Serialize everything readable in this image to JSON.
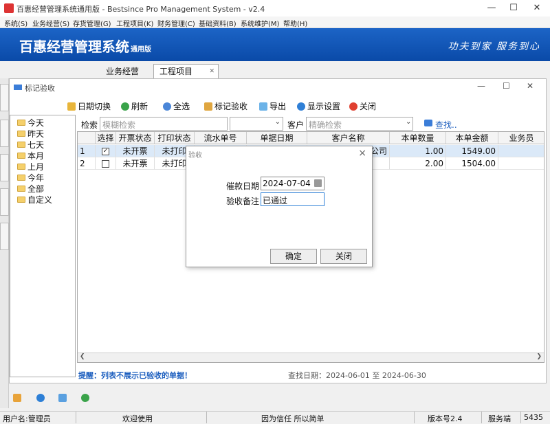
{
  "window": {
    "title": "百惠经营管理系统通用版 - Bestsince Pro Management System - v2.4",
    "minimize": "—",
    "maximize": "☐",
    "close": "✕"
  },
  "menu": [
    "系统(S)",
    "业务经营(S)",
    "存货管理(G)",
    "工程项目(K)",
    "财务管理(C)",
    "基础资料(B)",
    "系统维护(M)",
    "帮助(H)"
  ],
  "banner": {
    "brand": "百惠经营管理系统",
    "edition": "通用版",
    "slogan": "功夫到家 服务到心"
  },
  "tabs": [
    "业务经营",
    "工程项目"
  ],
  "tab_close": "✕",
  "inner": {
    "title": "标记验收",
    "minimize": "—",
    "maximize": "☐",
    "close": "✕"
  },
  "toolbar": {
    "date_toggle": "日期切换",
    "refresh": "刷新",
    "select_all": "全选",
    "mark_accept": "标记验收",
    "export": "导出",
    "display_settings": "显示设置",
    "close": "关闭"
  },
  "tree": [
    "今天",
    "昨天",
    "七天",
    "本月",
    "上月",
    "今年",
    "全部",
    "自定义"
  ],
  "search": {
    "label": "检索",
    "fuzzy_placeholder": "模糊检索",
    "customer_label": "客户",
    "exact_placeholder": "精确检索",
    "find": "查找.."
  },
  "grid": {
    "headers": [
      "选择",
      "开票状态",
      "打印状态",
      "流水单号",
      "单据日期",
      "客户名称",
      "本单数量",
      "本单金额",
      "业务员"
    ],
    "rows": [
      {
        "no": "1",
        "checked": "✓",
        "invoice": "未开票",
        "print": "未打印",
        "serial": "",
        "date": "",
        "customer": "公司",
        "qty": "1.00",
        "amount": "1549.00",
        "salesman": ""
      },
      {
        "no": "2",
        "checked": "",
        "invoice": "未开票",
        "print": "未打印",
        "serial": "",
        "date": "",
        "customer": "",
        "qty": "2.00",
        "amount": "1504.00",
        "salesman": ""
      }
    ]
  },
  "footnote": {
    "tip": "提醒：列表不展示已验收的单据！",
    "range": "查找日期：2024-06-01 至 2024-06-30"
  },
  "dialog": {
    "title": "验收",
    "date_label": "催款日期",
    "date_value": "2024-07-04",
    "note_label": "验收备注",
    "note_value": "已通过",
    "ok": "确定",
    "close": "关闭"
  },
  "status": {
    "user": "用户名:管理员",
    "welcome": "欢迎使用",
    "motto": "因为信任 所以简单",
    "version": "版本号2.4",
    "server": "服务端",
    "extra": "5435"
  },
  "colors": {
    "banner": "#1c64c6",
    "selected_row": "#dbe9f8",
    "link": "#1d5fbf"
  }
}
